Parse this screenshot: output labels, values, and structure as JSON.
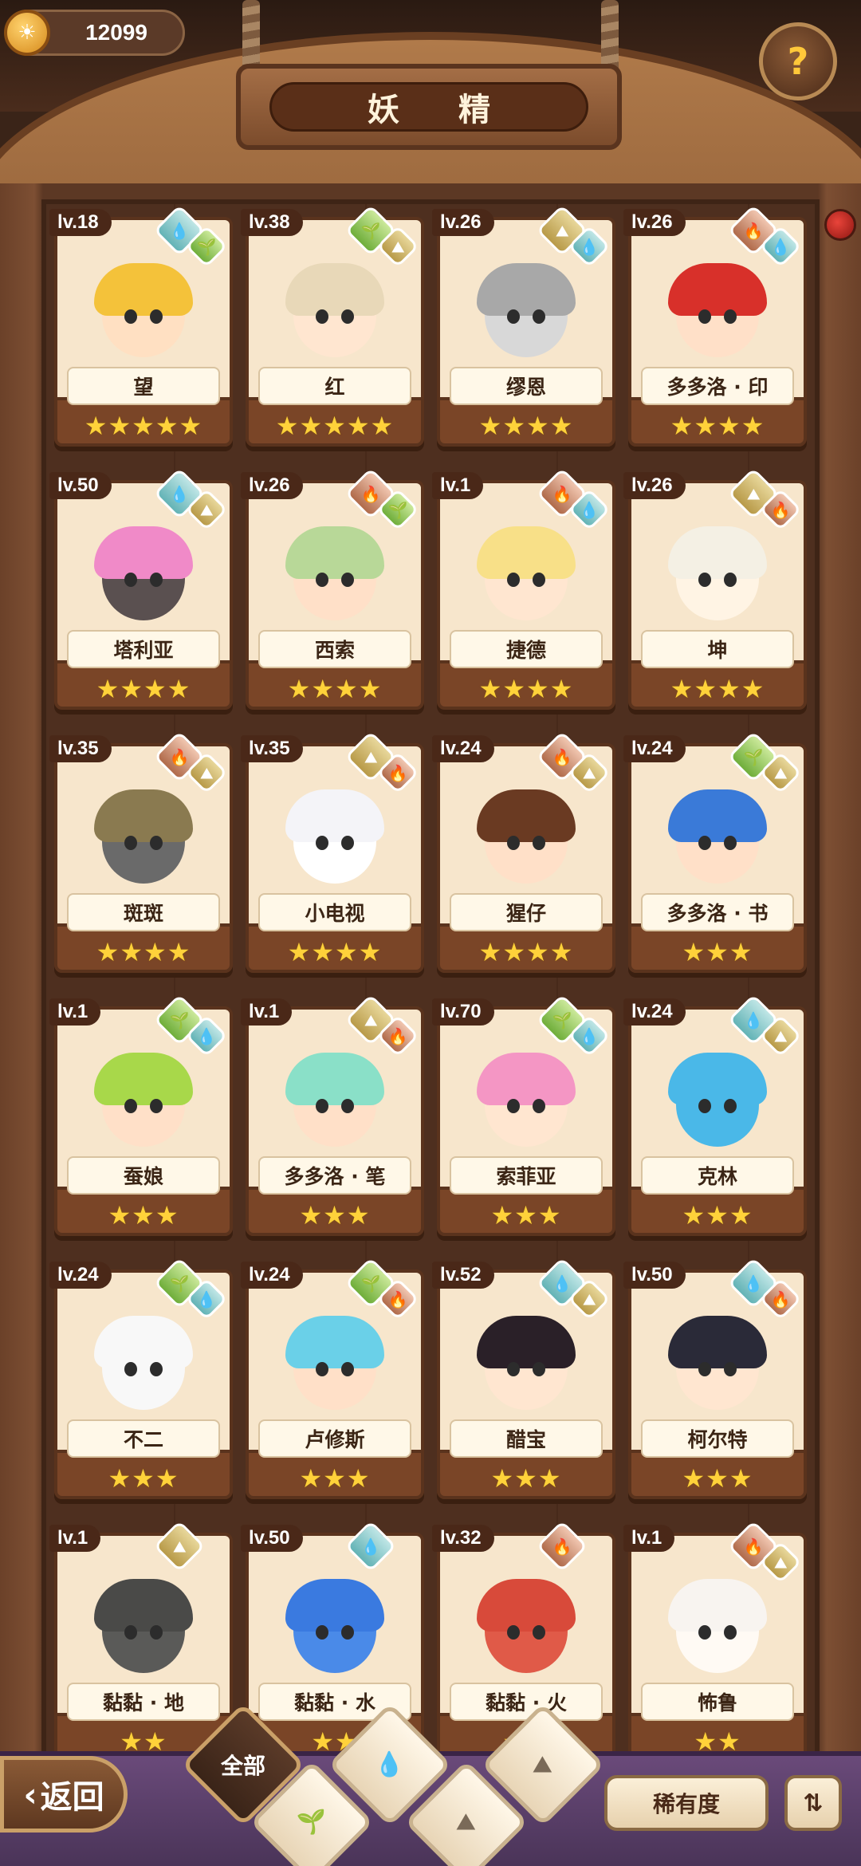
{
  "header": {
    "coin_icon": "coin-icon",
    "coin_symbol": "☀",
    "coins": "12099",
    "title": "妖 精",
    "help_icon": "help-icon",
    "help_glyph": "?"
  },
  "fairies": [
    {
      "level": "lv.18",
      "name": "望",
      "stars": "★★★★★",
      "elements": [
        "water",
        "plant"
      ],
      "hair": "#f4c23a",
      "skin": "#ffe0c2"
    },
    {
      "level": "lv.38",
      "name": "红",
      "stars": "★★★★★",
      "elements": [
        "plant",
        "earth"
      ],
      "hair": "#e8d8b8",
      "skin": "#ffe6d0"
    },
    {
      "level": "lv.26",
      "name": "缪恩",
      "stars": "★★★★",
      "elements": [
        "earth",
        "water"
      ],
      "hair": "#a8a8a8",
      "skin": "#d8d8d8"
    },
    {
      "level": "lv.26",
      "name": "多多洛 · 印",
      "stars": "★★★★",
      "elements": [
        "fire",
        "water"
      ],
      "hair": "#d8302a",
      "skin": "#ffe0c8"
    },
    {
      "level": "lv.50",
      "name": "塔利亚",
      "stars": "★★★★",
      "elements": [
        "water",
        "earth"
      ],
      "hair": "#f08ac8",
      "skin": "#5a5050"
    },
    {
      "level": "lv.26",
      "name": "西索",
      "stars": "★★★★",
      "elements": [
        "fire",
        "plant"
      ],
      "hair": "#b8d898",
      "skin": "#ffe0c8"
    },
    {
      "level": "lv.1",
      "name": "捷德",
      "stars": "★★★★",
      "elements": [
        "fire",
        "water"
      ],
      "hair": "#f8e088",
      "skin": "#ffe6d0"
    },
    {
      "level": "lv.26",
      "name": "坤",
      "stars": "★★★★",
      "elements": [
        "earth",
        "fire"
      ],
      "hair": "#f4f0e4",
      "skin": "#fff4e4"
    },
    {
      "level": "lv.35",
      "name": "斑斑",
      "stars": "★★★★",
      "elements": [
        "fire",
        "earth"
      ],
      "hair": "#8a7a50",
      "skin": "#6a6a6a"
    },
    {
      "level": "lv.35",
      "name": "小电视",
      "stars": "★★★★",
      "elements": [
        "earth",
        "fire"
      ],
      "hair": "#f4f4f8",
      "skin": "#ffffff"
    },
    {
      "level": "lv.24",
      "name": "猩仔",
      "stars": "★★★★",
      "elements": [
        "fire",
        "earth"
      ],
      "hair": "#6a3a22",
      "skin": "#ffe0c8"
    },
    {
      "level": "lv.24",
      "name": "多多洛 · 书",
      "stars": "★★★",
      "elements": [
        "plant",
        "earth"
      ],
      "hair": "#3a7ad8",
      "skin": "#ffe0c8"
    },
    {
      "level": "lv.1",
      "name": "蚕娘",
      "stars": "★★★",
      "elements": [
        "plant",
        "water"
      ],
      "hair": "#a8d84a",
      "skin": "#ffe0c8"
    },
    {
      "level": "lv.1",
      "name": "多多洛 · 笔",
      "stars": "★★★",
      "elements": [
        "earth",
        "fire"
      ],
      "hair": "#8ae0c8",
      "skin": "#ffe0c8"
    },
    {
      "level": "lv.70",
      "name": "索菲亚",
      "stars": "★★★",
      "elements": [
        "plant",
        "water"
      ],
      "hair": "#f496c4",
      "skin": "#ffe6d0"
    },
    {
      "level": "lv.24",
      "name": "克林",
      "stars": "★★★",
      "elements": [
        "water",
        "earth"
      ],
      "hair": "#4ab8e8",
      "skin": "#4ab8e8"
    },
    {
      "level": "lv.24",
      "name": "不二",
      "stars": "★★★",
      "elements": [
        "plant",
        "water"
      ],
      "hair": "#f8f8f8",
      "skin": "#f8f8f8"
    },
    {
      "level": "lv.24",
      "name": "卢修斯",
      "stars": "★★★",
      "elements": [
        "plant",
        "fire"
      ],
      "hair": "#6ad0e8",
      "skin": "#ffe0c8"
    },
    {
      "level": "lv.52",
      "name": "醋宝",
      "stars": "★★★",
      "elements": [
        "water",
        "earth"
      ],
      "hair": "#2a2028",
      "skin": "#ffe6d0"
    },
    {
      "level": "lv.50",
      "name": "柯尔特",
      "stars": "★★★",
      "elements": [
        "water",
        "fire"
      ],
      "hair": "#2a2a38",
      "skin": "#ffe6d0"
    },
    {
      "level": "lv.1",
      "name": "黏黏 · 地",
      "stars": "★★",
      "elements": [
        "earth"
      ],
      "hair": "#4a4a48",
      "skin": "#5a5a58"
    },
    {
      "level": "lv.50",
      "name": "黏黏 · 水",
      "stars": "★★",
      "elements": [
        "water"
      ],
      "hair": "#3a7ae0",
      "skin": "#4a8ae8"
    },
    {
      "level": "lv.32",
      "name": "黏黏 · 火",
      "stars": "★★",
      "elements": [
        "fire"
      ],
      "hair": "#d84a3a",
      "skin": "#e05a48"
    },
    {
      "level": "lv.1",
      "name": "怖鲁",
      "stars": "★★",
      "elements": [
        "fire",
        "earth"
      ],
      "hair": "#f8f4f0",
      "skin": "#fffaf4"
    }
  ],
  "element_glyphs": {
    "water": "💧",
    "plant": "🌱",
    "earth": "⛰",
    "fire": "🔥"
  },
  "footer": {
    "back_label": "返回",
    "back_icon": "chevron-left-icon",
    "filter_all": "全部",
    "filter_icons": [
      "plant-icon",
      "water-icon",
      "earth-icon",
      "fire-icon"
    ],
    "filter_glyphs": {
      "plant": "🌱",
      "water": "💧",
      "earth": "⛰",
      "fire": "⛰"
    },
    "rarity_label": "稀有度",
    "sort_icon": "sort-icon",
    "sort_glyph": "⇅"
  },
  "colors": {
    "accent": "#ffd23a",
    "wood": "#6b4129",
    "card": "#f7e6cc"
  }
}
